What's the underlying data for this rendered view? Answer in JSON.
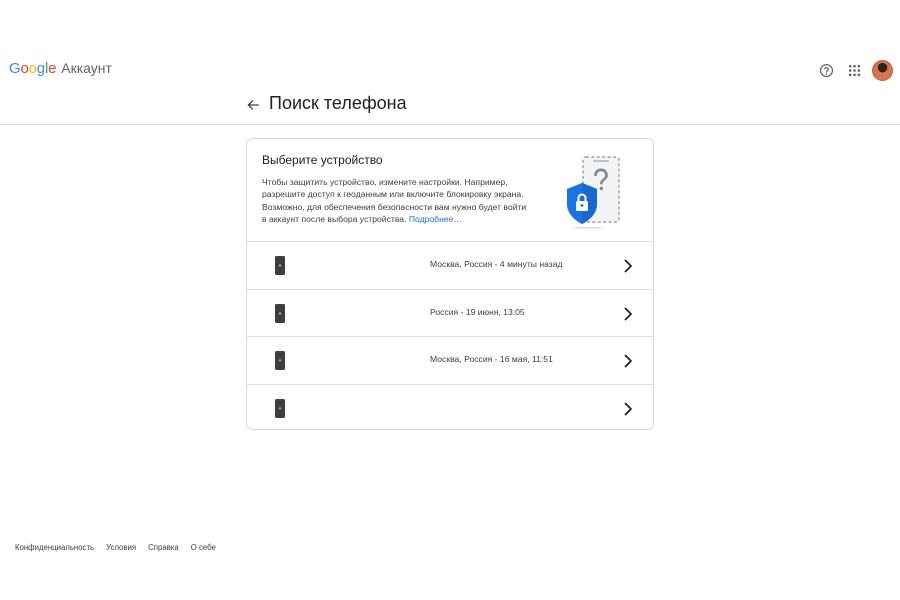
{
  "app": {
    "logo_letters": [
      {
        "char": "G",
        "color": "#4285f4"
      },
      {
        "char": "o",
        "color": "#ea4335"
      },
      {
        "char": "o",
        "color": "#fbbc05"
      },
      {
        "char": "g",
        "color": "#4285f4"
      },
      {
        "char": "l",
        "color": "#34a853"
      },
      {
        "char": "e",
        "color": "#ea4335"
      }
    ],
    "product": "Аккаунт"
  },
  "topbar": {
    "icons": [
      "help-icon",
      "apps-grid-icon",
      "avatar"
    ]
  },
  "header": {
    "title": "Поиск телефона",
    "back_icon": "arrow-back-icon"
  },
  "intro": {
    "title": "Выберите устройство",
    "description": "Чтобы защитить устройство, измените настройки. Например, разрешите доступ к геоданным или включите блокировку экрана. Возможно, для обеспечения безопасности вам нужно будет войти в аккаунт после выбора устройства.",
    "link": "Подробнее…",
    "illustration": "shield-lock-phone-illustration"
  },
  "devices": [
    {
      "location": "Москва, Россия - 4 минуты назад",
      "icon": "iphone-icon"
    },
    {
      "location": "Россия - 19 июня, 13:05",
      "icon": "iphone-icon"
    },
    {
      "location": "Москва, Россия - 16 мая, 11:51",
      "icon": "iphone-icon"
    },
    {
      "location": "",
      "icon": "iphone-icon"
    }
  ],
  "footer": {
    "links": [
      "Конфиденциальность",
      "Условия",
      "Справка",
      "О себе"
    ]
  },
  "colors": {
    "accent": "#1a73e8",
    "shield": "#1a73e8",
    "divider": "#dadce0",
    "phone": "#3c4043"
  }
}
